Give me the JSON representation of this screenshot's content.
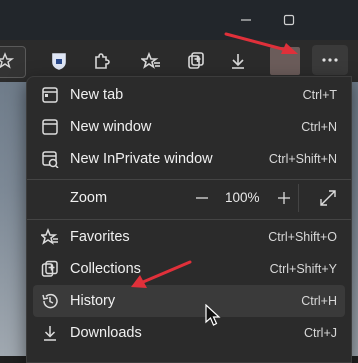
{
  "window": {
    "controls": [
      "minimize",
      "maximize"
    ]
  },
  "toolbar": {
    "icons": [
      "favorites-star-icon",
      "extension-shield-icon",
      "extensions-puzzle-icon",
      "favorites-icon",
      "collections-icon",
      "downloads-icon"
    ],
    "more_label": "..."
  },
  "menu": {
    "items": [
      {
        "label": "New tab",
        "shortcut": "Ctrl+T",
        "icon": "new-tab-icon"
      },
      {
        "label": "New window",
        "shortcut": "Ctrl+N",
        "icon": "new-window-icon"
      },
      {
        "label": "New InPrivate window",
        "shortcut": "Ctrl+Shift+N",
        "icon": "inprivate-icon"
      },
      {
        "label": "Favorites",
        "shortcut": "Ctrl+Shift+O",
        "icon": "favorites-icon"
      },
      {
        "label": "Collections",
        "shortcut": "Ctrl+Shift+Y",
        "icon": "collections-icon"
      },
      {
        "label": "History",
        "shortcut": "Ctrl+H",
        "icon": "history-icon"
      },
      {
        "label": "Downloads",
        "shortcut": "Ctrl+J",
        "icon": "downloads-icon"
      }
    ],
    "zoom": {
      "label": "Zoom",
      "minus": "—",
      "value": "100%",
      "plus": "+"
    }
  },
  "colors": {
    "annotation_arrow": "#e0303a",
    "menu_bg": "#2b2b2b",
    "hover_bg": "#3a3a3a"
  }
}
